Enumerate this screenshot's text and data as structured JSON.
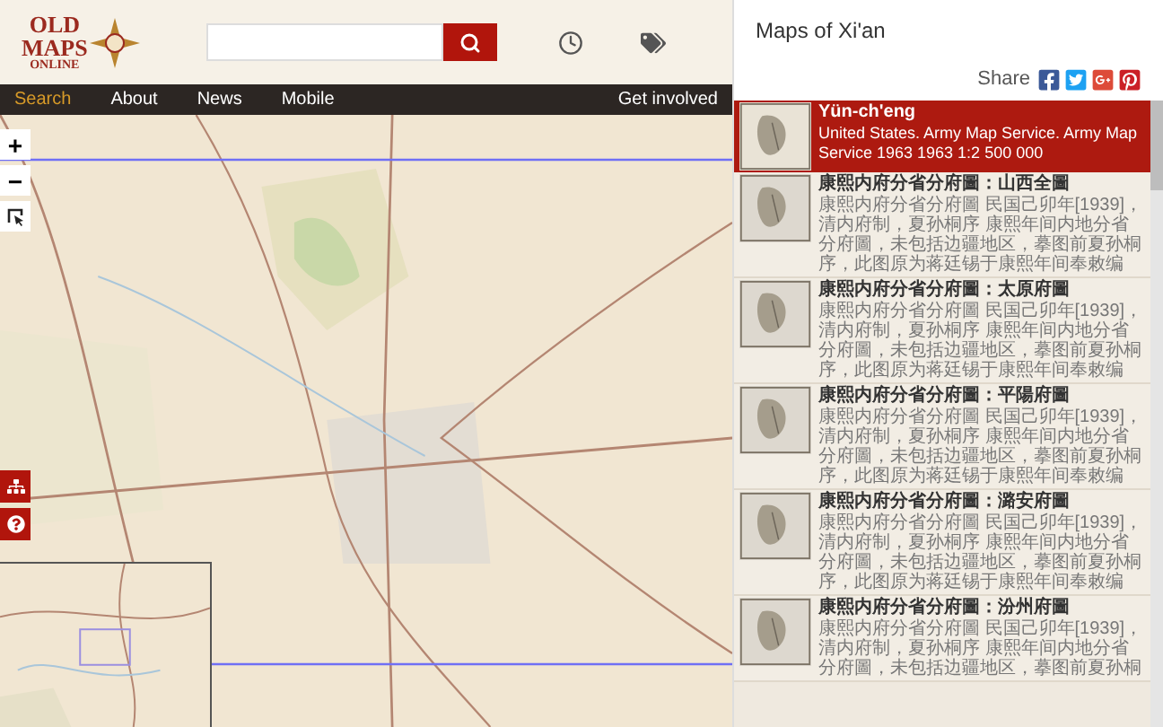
{
  "logo": {
    "lines": [
      "OLD",
      "MAPS",
      "ONLINE"
    ]
  },
  "nav": [
    {
      "label": "Search",
      "selected": true
    },
    {
      "label": "About",
      "selected": false
    },
    {
      "label": "News",
      "selected": false
    },
    {
      "label": "Mobile",
      "selected": false
    }
  ],
  "nav_right": "Get involved",
  "map_controls": {
    "zoom_in": "+",
    "zoom_out": "−"
  },
  "panel": {
    "title": "Maps of Xi'an",
    "share_label": "Share",
    "results": [
      {
        "title": "Yün-ch'eng",
        "description": "United States. Army Map Service. Army Map Service 1963 1963 1:2 500 000",
        "selected": true
      },
      {
        "title": "康熙内府分省分府圖：山西全圖",
        "description": "康熙内府分省分府圖 民国己卯年[1939]，清内府制，夏孙桐序 康熙年间内地分省分府圖，未包括边疆地区，摹图前夏孙桐序，此图原为蒋廷锡于康熙年间奉敕编",
        "selected": false
      },
      {
        "title": "康熙内府分省分府圖：太原府圖",
        "description": "康熙内府分省分府圖 民国己卯年[1939]，清内府制，夏孙桐序 康熙年间内地分省分府圖，未包括边疆地区，摹图前夏孙桐序，此图原为蒋廷锡于康熙年间奉敕编",
        "selected": false
      },
      {
        "title": "康熙内府分省分府圖：平陽府圖",
        "description": "康熙内府分省分府圖 民国己卯年[1939]，清内府制，夏孙桐序 康熙年间内地分省分府圖，未包括边疆地区，摹图前夏孙桐序，此图原为蒋廷锡于康熙年间奉敕编",
        "selected": false
      },
      {
        "title": "康熙内府分省分府圖：潞安府圖",
        "description": "康熙内府分省分府圖 民国己卯年[1939]，清内府制，夏孙桐序 康熙年间内地分省分府圖，未包括边疆地区，摹图前夏孙桐序，此图原为蒋廷锡于康熙年间奉敕编",
        "selected": false
      },
      {
        "title": "康熙内府分省分府圖：汾州府圖",
        "description": "康熙内府分省分府圖 民国己卯年[1939]，清内府制，夏孙桐序 康熙年间内地分省分府圖，未包括边疆地区，摹图前夏孙桐",
        "selected": false
      }
    ]
  }
}
